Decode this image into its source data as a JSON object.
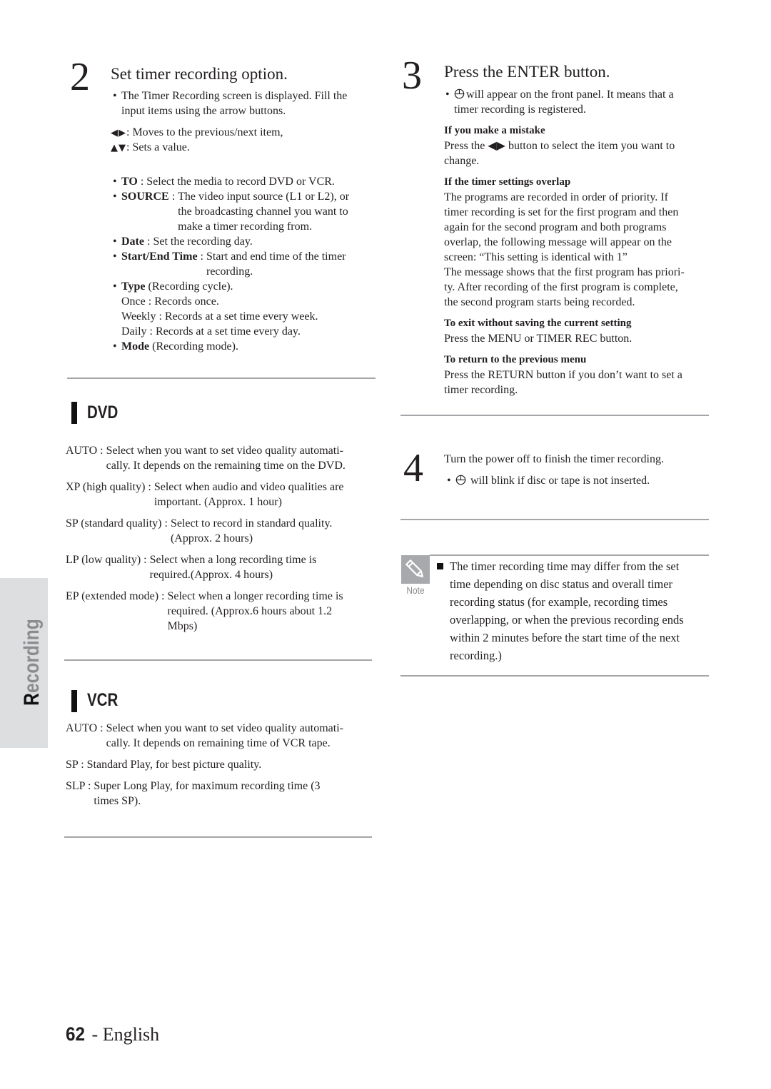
{
  "sidebar_tab": {
    "label_first": "R",
    "label_rest": "ecording"
  },
  "step2": {
    "number": "2",
    "title": "Set timer recording option.",
    "intro_lines": [
      "The Timer Recording screen is displayed. Fill the",
      "input items using the arrow buttons."
    ],
    "arrow_keys": [
      {
        "keys": "◀▶",
        "text": ": Moves to the previous/next item,"
      },
      {
        "keys": "▲▼",
        "text": ": Sets a value."
      }
    ],
    "items": [
      {
        "term": "TO",
        "sep": " : ",
        "lines": [
          "Select the media to record DVD or VCR."
        ]
      },
      {
        "term": "SOURCE",
        "sep": " : ",
        "lines": [
          "The video input source (L1 or L2), or",
          "the broadcasting channel you want to",
          "make a timer recording from."
        ]
      },
      {
        "term": "Date",
        "sep": " : ",
        "lines": [
          "Set the recording day."
        ]
      },
      {
        "term": "Start/End Time",
        "sep": " : ",
        "lines": [
          "Start and end time of the timer",
          "recording."
        ]
      },
      {
        "term": "Type",
        "sep": " ",
        "lines": [
          "(Recording cycle)."
        ],
        "sub_lines": [
          "Once : Records once.",
          "Weekly : Records at a set time every week.",
          "Daily : Records at a set time every day."
        ]
      },
      {
        "term": "Mode",
        "sep": " ",
        "lines": [
          "(Recording mode)."
        ]
      }
    ]
  },
  "dvd": {
    "heading": "DVD",
    "modes": [
      {
        "label": "AUTO : ",
        "lines": [
          "Select when you want to set video quality automati-",
          "cally. It depends on the remaining time on the DVD."
        ]
      },
      {
        "label": "XP (high quality) : ",
        "lines": [
          "Select when audio and video qualities are",
          "important. (Approx. 1 hour)"
        ]
      },
      {
        "label": "SP (standard quality) : ",
        "lines": [
          "Select to record in standard quality.",
          "(Approx. 2 hours)"
        ]
      },
      {
        "label": "LP (low quality) : ",
        "lines": [
          "Select when a long recording time is",
          "required.(Approx. 4 hours)"
        ]
      },
      {
        "label": "EP (extended mode) : ",
        "lines": [
          "Select when a longer recording time is",
          "required. (Approx.6 hours about 1.2",
          "Mbps)"
        ]
      }
    ]
  },
  "vcr": {
    "heading": "VCR",
    "modes": [
      {
        "label": "AUTO : ",
        "lines": [
          "Select when you want to set video quality automati-",
          "cally. It depends on remaining time of VCR tape."
        ]
      },
      {
        "label": "SP : ",
        "lines": [
          "Standard Play, for best picture quality."
        ]
      },
      {
        "label": "SLP : ",
        "lines": [
          "Super Long Play, for maximum recording time (3",
          "times SP)."
        ]
      }
    ]
  },
  "step3": {
    "number": "3",
    "title": "Press the ENTER button.",
    "bullet_icon": "timer-clock-icon",
    "bullet_lines": [
      "will appear on the front panel. It means that a",
      "timer recording is registered."
    ],
    "subsections": [
      {
        "heading": "If you make a mistake",
        "lines": [
          "Press the ◀▶ button to select the item you want to",
          "change."
        ]
      },
      {
        "heading": "If the timer settings overlap",
        "lines": [
          "The programs are recorded in order of priority. If",
          "timer recording is set for the first program and then",
          "again for the second program and both programs",
          "overlap, the following message will appear on the",
          "screen: “This setting is identical with 1”",
          "The message shows that the first program has priori-",
          "ty. After recording of the first program is complete,",
          "the second program starts being recorded."
        ]
      },
      {
        "heading": "To exit without saving the current setting",
        "lines": [
          "Press the MENU or TIMER REC button."
        ]
      },
      {
        "heading": "To return to the previous menu",
        "lines": [
          "Press the RETURN button if you don’t want to set a",
          "timer recording."
        ]
      }
    ]
  },
  "step4": {
    "number": "4",
    "text": "Turn the power off to finish the timer recording.",
    "bullet_icon": "timer-clock-icon",
    "bullet_text": "will blink if disc or tape is not inserted."
  },
  "note": {
    "label": "Note",
    "icon": "pencil-icon",
    "lines": [
      "The timer recording time may differ from the set",
      "time depending on disc status and overall timer",
      "recording status (for example, recording times",
      "overlapping, or when the previous recording ends",
      "within 2 minutes before the start time of the next",
      "recording.)"
    ]
  },
  "footer": {
    "page_number": "62",
    "separator": " - ",
    "language": "English"
  }
}
